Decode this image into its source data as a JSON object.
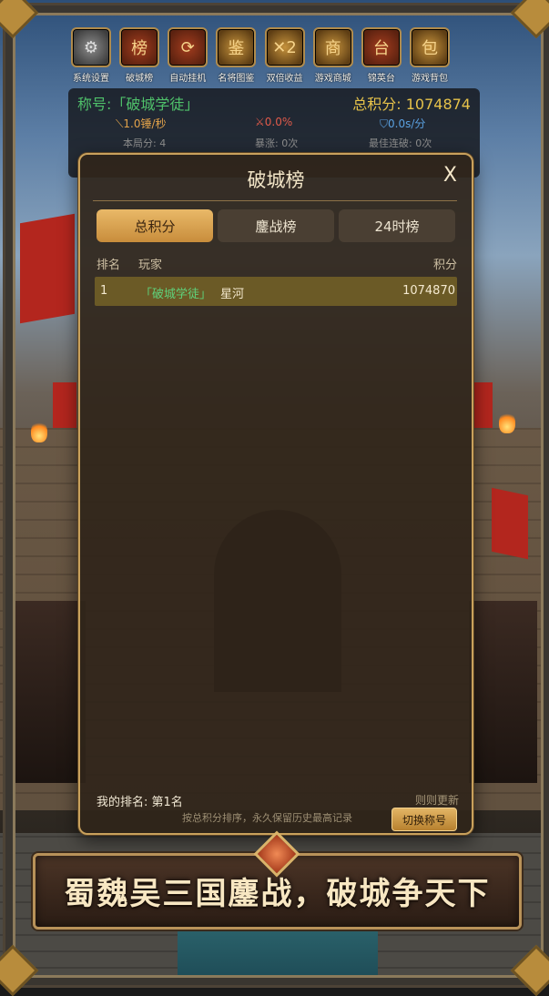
{
  "icons": [
    {
      "label": "系统设置",
      "name": "settings-icon",
      "glyph": "⚙",
      "style": "gray"
    },
    {
      "label": "破城榜",
      "name": "rank-icon",
      "glyph": "榜",
      "style": "red"
    },
    {
      "label": "自动挂机",
      "name": "auto-icon",
      "glyph": "⟳",
      "style": "red"
    },
    {
      "label": "名将图鉴",
      "name": "book-icon",
      "glyph": "鉴",
      "style": "gold"
    },
    {
      "label": "双倍收益",
      "name": "double-icon",
      "glyph": "✕2",
      "style": "gold"
    },
    {
      "label": "游戏商城",
      "name": "shop-icon",
      "glyph": "商",
      "style": "gold"
    },
    {
      "label": "锦英台",
      "name": "tower-icon",
      "glyph": "台",
      "style": "red"
    },
    {
      "label": "游戏背包",
      "name": "bag-icon",
      "glyph": "包",
      "style": "gold"
    }
  ],
  "stats": {
    "title": "称号:「破城学徒」",
    "score": "总积分: 1074874",
    "speed": "1.0锤/秒",
    "crit": "0.0%",
    "time": "0.0s/分",
    "sub1": "本局分: 4",
    "sub2": "暴涨: 0次",
    "sub3": "最佳连破: 0次"
  },
  "modal": {
    "title": "破城榜",
    "close": "X",
    "tabs": [
      "总积分",
      "鏖战榜",
      "24时榜"
    ],
    "headers": {
      "rank": "排名",
      "player": "玩家",
      "score": "积分"
    },
    "rows": [
      {
        "rank": "1",
        "title": "「破城学徒」",
        "player": "星河",
        "score": "1074870"
      }
    ],
    "my_rank": "我的排名: 第1名",
    "rule": "则则更新",
    "note": "按总积分排序，永久保留历史最高记录",
    "switch": "切换称号"
  },
  "banner": "蜀魏吴三国鏖战，破城争天下",
  "colors": {
    "accent": "#c9a15c",
    "title_green": "#4fc16a",
    "score_gold": "#e6c24a"
  }
}
